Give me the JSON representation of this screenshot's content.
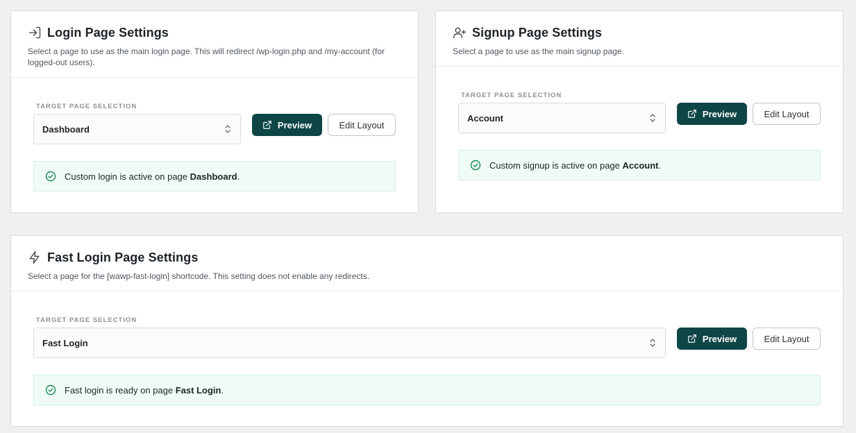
{
  "login": {
    "title": "Login Page Settings",
    "description": "Select a page to use as the main login page. This will redirect /wp-login.php and /my-account (for logged-out users).",
    "field_label": "TARGET PAGE SELECTION",
    "selected_page": "Dashboard",
    "preview_label": "Preview",
    "edit_label": "Edit Layout",
    "notice_prefix": "Custom login is active on page",
    "notice_page": "Dashboard",
    "notice_suffix": ".",
    "icon": "login-icon"
  },
  "signup": {
    "title": "Signup Page Settings",
    "description": "Select a page to use as the main signup page.",
    "field_label": "TARGET PAGE SELECTION",
    "selected_page": "Account",
    "preview_label": "Preview",
    "edit_label": "Edit Layout",
    "notice_prefix": "Custom signup is active on page",
    "notice_page": "Account",
    "notice_suffix": ".",
    "icon": "user-plus-icon"
  },
  "fast_login": {
    "title": "Fast Login Page Settings",
    "description": "Select a page for the [wawp-fast-login] shortcode. This setting does not enable any redirects.",
    "field_label": "TARGET PAGE SELECTION",
    "selected_page": "Fast Login",
    "preview_label": "Preview",
    "edit_label": "Edit Layout",
    "notice_prefix": "Fast login is ready on page",
    "notice_page": "Fast Login",
    "notice_suffix": ".",
    "icon": "lightning-icon"
  },
  "colors": {
    "primary_button": "#0e4646",
    "notice_background": "#f1fbf6",
    "notice_check": "#1a8a5a",
    "page_background": "#f0f0f1"
  }
}
